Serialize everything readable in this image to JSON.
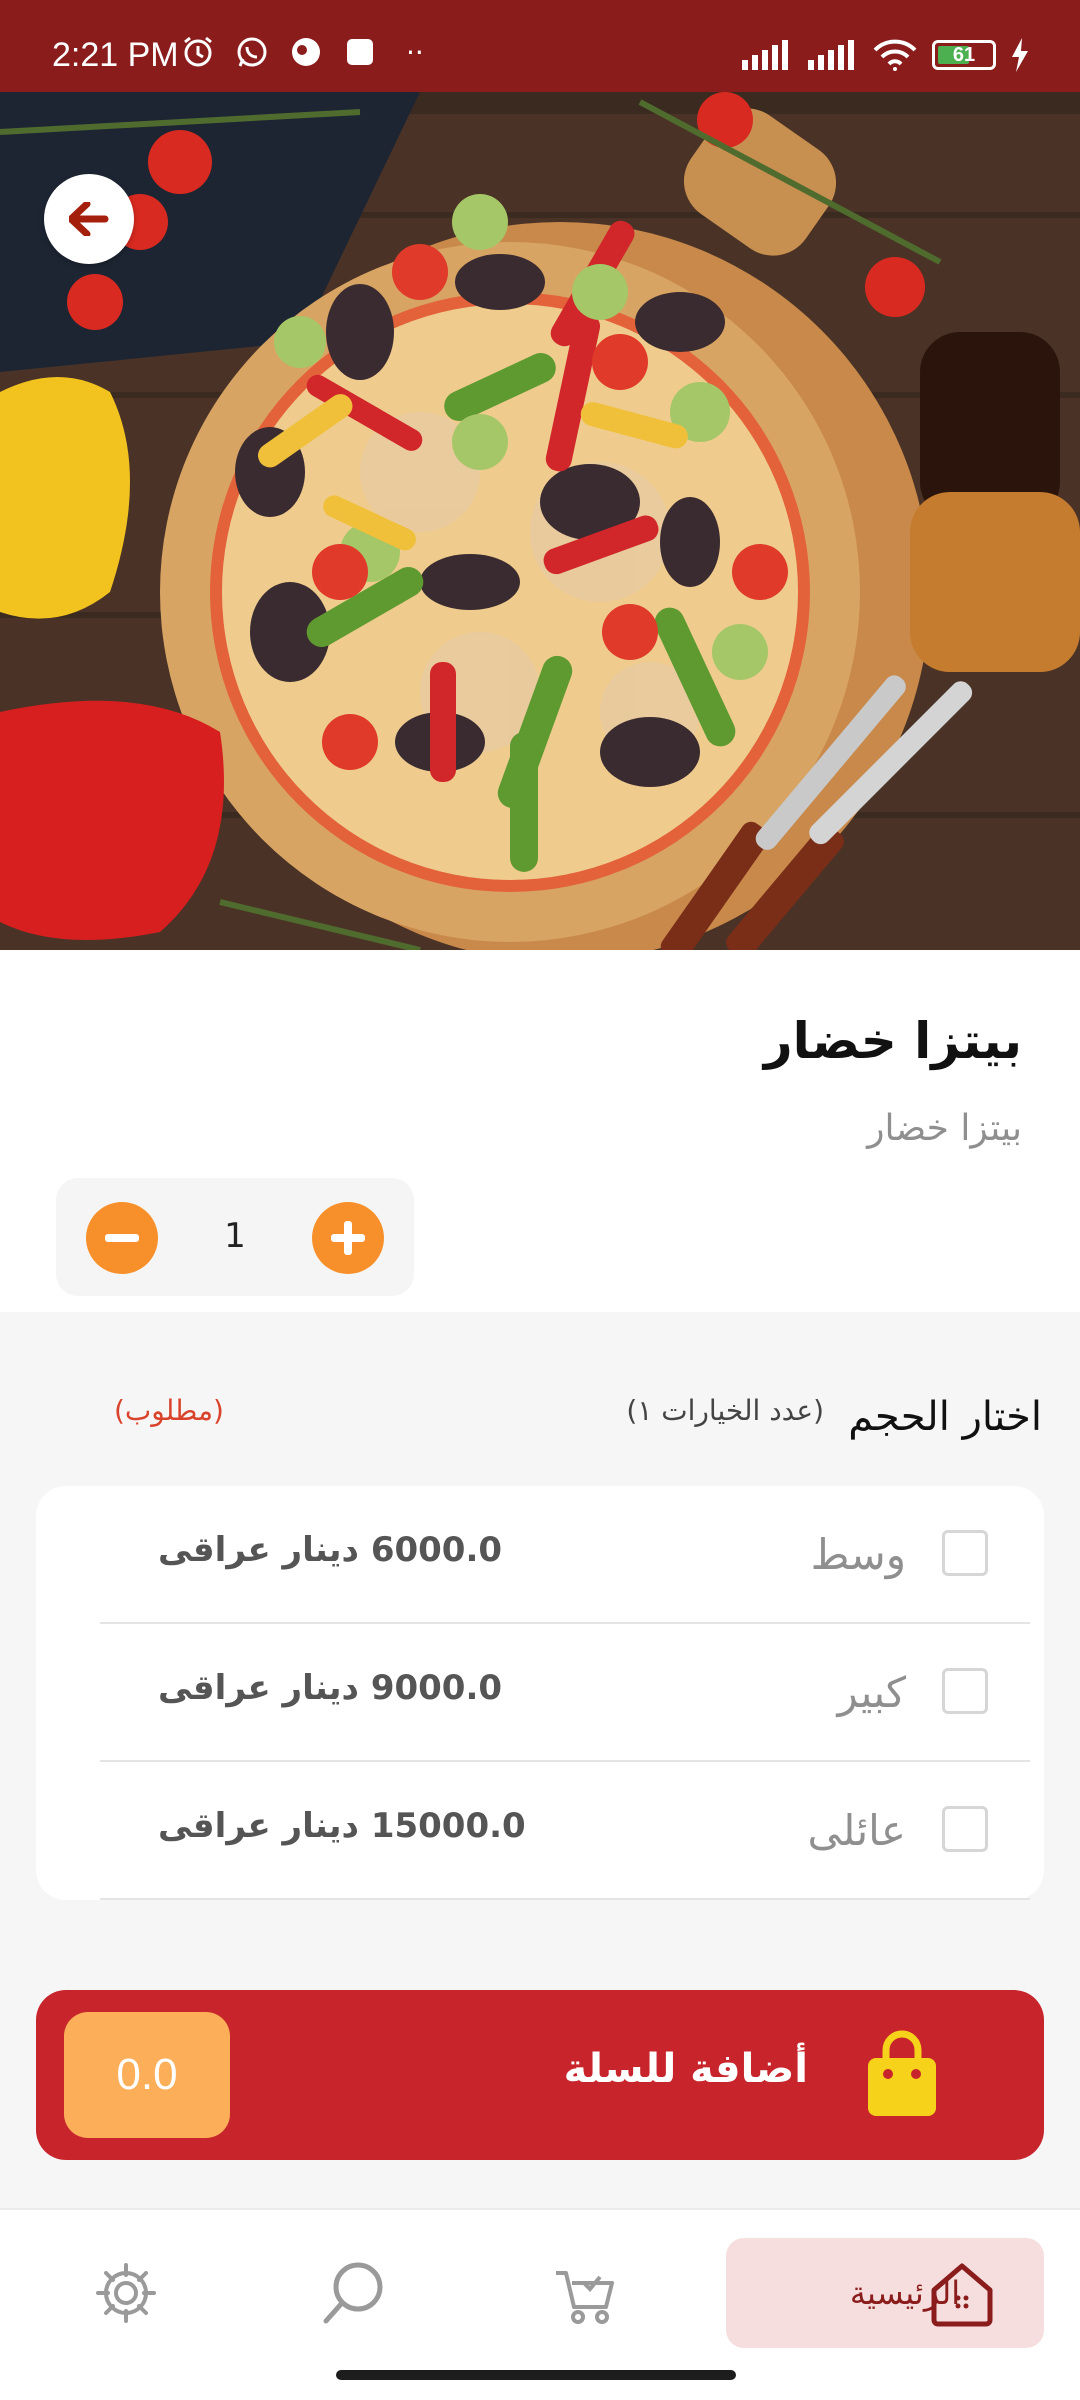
{
  "status_bar": {
    "time": "2:21 PM",
    "dots": "··",
    "battery_level": 61,
    "icons": [
      "alarm-icon",
      "whatsapp-icon",
      "app-icon",
      "notification-square-icon",
      "signal-icon",
      "signal-icon",
      "wifi-icon",
      "battery-icon",
      "charging-icon"
    ]
  },
  "header": {
    "back_icon": "arrow-left-icon"
  },
  "product": {
    "title": "بيتزا خضار",
    "description": "بيتزا خضار",
    "quantity": "1"
  },
  "size_section": {
    "title": "اختار الحجم",
    "options_count": "(عدد الخيارات ١)",
    "required": "(مطلوب)",
    "options": [
      {
        "name": "وسط",
        "price": "6000.0 دينار عراقى",
        "checked": false
      },
      {
        "name": "كبير",
        "price": "9000.0 دينار عراقى",
        "checked": false
      },
      {
        "name": "عائلى",
        "price": "15000.0 دينار عراقى",
        "checked": false
      }
    ]
  },
  "cart": {
    "label": "أضافة للسلة",
    "total": "0.0",
    "icon": "shopping-bag-icon"
  },
  "bottom_nav": {
    "home_label": "الرئيسية",
    "items": [
      "home-icon",
      "cart-icon",
      "search-icon",
      "settings-icon"
    ]
  },
  "colors": {
    "brand": "#8a1c1c",
    "accent_orange": "#f7902a",
    "cart_red": "#c8242c",
    "required_red": "#d9432b"
  }
}
